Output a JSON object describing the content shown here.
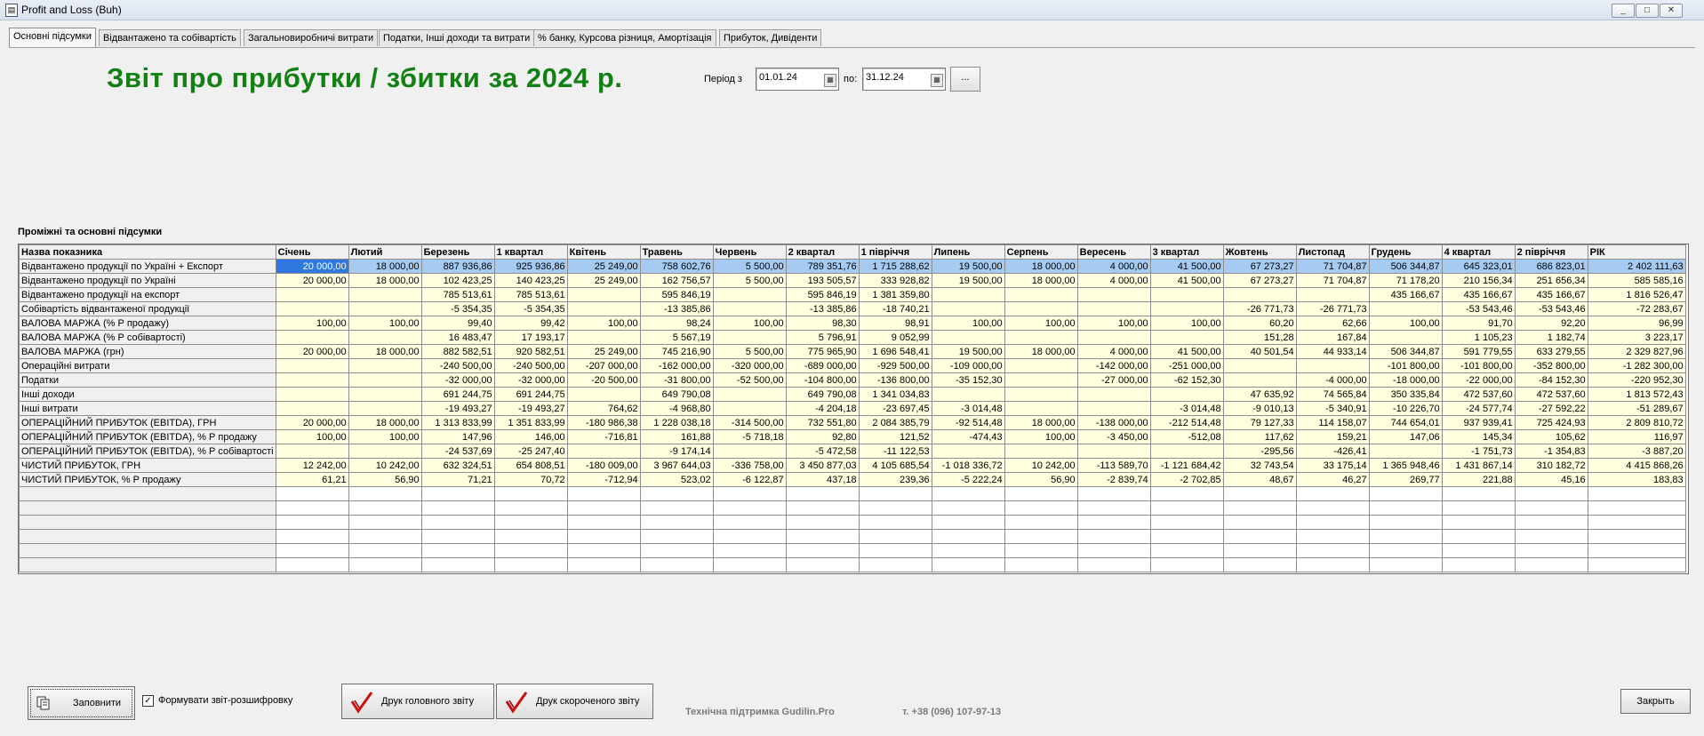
{
  "window": {
    "title": "Profit and Loss (Buh)",
    "minimize": "_",
    "maximize": "□",
    "close": "✕"
  },
  "tabs": [
    {
      "label": "Основні підсумки"
    },
    {
      "label": "Відвантажено та собівартість"
    },
    {
      "label": "Загальновиробничі витрати"
    },
    {
      "label": "Податки, Інші доходи та витрати"
    },
    {
      "label": "% банку, Курсова різниця, Амортізація"
    },
    {
      "label": "Прибуток, Дивіденти"
    }
  ],
  "report": {
    "title": "Звіт про прибутки / збитки за 2024 р.",
    "period_label": "Період з",
    "date_from": "01.01.24",
    "to_label": "по:",
    "date_to": "31.12.24",
    "more_button": "...",
    "section_title": "Проміжні та основні підсумки"
  },
  "table": {
    "columns": [
      "Назва показника",
      "Січень",
      "Лютий",
      "Березень",
      "1 квартал",
      "Квітень",
      "Травень",
      "Червень",
      "2 квартал",
      "1 півріччя",
      "Липень",
      "Серпень",
      "Вересень",
      "3 квартал",
      "Жовтень",
      "Листопад",
      "Грудень",
      "4 квартал",
      "2 півріччя",
      "РІК"
    ],
    "rows": [
      [
        "Відвантажено продукції по Україні + Експорт",
        "20 000,00",
        "18 000,00",
        "887 936,86",
        "925 936,86",
        "25 249,00",
        "758 602,76",
        "5 500,00",
        "789 351,76",
        "1 715 288,62",
        "19 500,00",
        "18 000,00",
        "4 000,00",
        "41 500,00",
        "67 273,27",
        "71 704,87",
        "506 344,87",
        "645 323,01",
        "686 823,01",
        "2 402 111,63"
      ],
      [
        "Відвантажено продукції по Україні",
        "20 000,00",
        "18 000,00",
        "102 423,25",
        "140 423,25",
        "25 249,00",
        "162 756,57",
        "5 500,00",
        "193 505,57",
        "333 928,82",
        "19 500,00",
        "18 000,00",
        "4 000,00",
        "41 500,00",
        "67 273,27",
        "71 704,87",
        "71 178,20",
        "210 156,34",
        "251 656,34",
        "585 585,16"
      ],
      [
        "Відвантажено продукції на експорт",
        "",
        "",
        "785 513,61",
        "785 513,61",
        "",
        "595 846,19",
        "",
        "595 846,19",
        "1 381 359,80",
        "",
        "",
        "",
        "",
        "",
        "",
        "435 166,67",
        "435 166,67",
        "435 166,67",
        "1 816 526,47"
      ],
      [
        "Собівартість відвантаженої продукції",
        "",
        "",
        "-5 354,35",
        "-5 354,35",
        "",
        "-13 385,86",
        "",
        "-13 385,86",
        "-18 740,21",
        "",
        "",
        "",
        "",
        "-26 771,73",
        "-26 771,73",
        "",
        "-53 543,46",
        "-53 543,46",
        "-72 283,67"
      ],
      [
        "ВАЛОВА МАРЖА (% Р продажу)",
        "100,00",
        "100,00",
        "99,40",
        "99,42",
        "100,00",
        "98,24",
        "100,00",
        "98,30",
        "98,91",
        "100,00",
        "100,00",
        "100,00",
        "100,00",
        "60,20",
        "62,66",
        "100,00",
        "91,70",
        "92,20",
        "96,99"
      ],
      [
        "ВАЛОВА МАРЖА (% Р собівартості)",
        "",
        "",
        "16 483,47",
        "17 193,17",
        "",
        "5 567,19",
        "",
        "5 796,91",
        "9 052,99",
        "",
        "",
        "",
        "",
        "151,28",
        "167,84",
        "",
        "1 105,23",
        "1 182,74",
        "3 223,17"
      ],
      [
        "ВАЛОВА МАРЖА (грн)",
        "20 000,00",
        "18 000,00",
        "882 582,51",
        "920 582,51",
        "25 249,00",
        "745 216,90",
        "5 500,00",
        "775 965,90",
        "1 696 548,41",
        "19 500,00",
        "18 000,00",
        "4 000,00",
        "41 500,00",
        "40 501,54",
        "44 933,14",
        "506 344,87",
        "591 779,55",
        "633 279,55",
        "2 329 827,96"
      ],
      [
        "Операційні витрати",
        "",
        "",
        "-240 500,00",
        "-240 500,00",
        "-207 000,00",
        "-162 000,00",
        "-320 000,00",
        "-689 000,00",
        "-929 500,00",
        "-109 000,00",
        "",
        "-142 000,00",
        "-251 000,00",
        "",
        "",
        "-101 800,00",
        "-101 800,00",
        "-352 800,00",
        "-1 282 300,00"
      ],
      [
        "Податки",
        "",
        "",
        "-32 000,00",
        "-32 000,00",
        "-20 500,00",
        "-31 800,00",
        "-52 500,00",
        "-104 800,00",
        "-136 800,00",
        "-35 152,30",
        "",
        "-27 000,00",
        "-62 152,30",
        "",
        "-4 000,00",
        "-18 000,00",
        "-22 000,00",
        "-84 152,30",
        "-220 952,30"
      ],
      [
        "Інші доходи",
        "",
        "",
        "691 244,75",
        "691 244,75",
        "",
        "649 790,08",
        "",
        "649 790,08",
        "1 341 034,83",
        "",
        "",
        "",
        "",
        "47 635,92",
        "74 565,84",
        "350 335,84",
        "472 537,60",
        "472 537,60",
        "1 813 572,43"
      ],
      [
        "Інші витрати",
        "",
        "",
        "-19 493,27",
        "-19 493,27",
        "764,62",
        "-4 968,80",
        "",
        "-4 204,18",
        "-23 697,45",
        "-3 014,48",
        "",
        "",
        "-3 014,48",
        "-9 010,13",
        "-5 340,91",
        "-10 226,70",
        "-24 577,74",
        "-27 592,22",
        "-51 289,67"
      ],
      [
        "ОПЕРАЦІЙНИЙ ПРИБУТОК (EBITDA), ГРН",
        "20 000,00",
        "18 000,00",
        "1 313 833,99",
        "1 351 833,99",
        "-180 986,38",
        "1 228 038,18",
        "-314 500,00",
        "732 551,80",
        "2 084 385,79",
        "-92 514,48",
        "18 000,00",
        "-138 000,00",
        "-212 514,48",
        "79 127,33",
        "114 158,07",
        "744 654,01",
        "937 939,41",
        "725 424,93",
        "2 809 810,72"
      ],
      [
        "ОПЕРАЦІЙНИЙ ПРИБУТОК (EBITDA), % Р продажу",
        "100,00",
        "100,00",
        "147,96",
        "146,00",
        "-716,81",
        "161,88",
        "-5 718,18",
        "92,80",
        "121,52",
        "-474,43",
        "100,00",
        "-3 450,00",
        "-512,08",
        "117,62",
        "159,21",
        "147,06",
        "145,34",
        "105,62",
        "116,97"
      ],
      [
        "ОПЕРАЦІЙНИЙ ПРИБУТОК (EBITDA), % Р собівартості",
        "",
        "",
        "-24 537,69",
        "-25 247,40",
        "",
        "-9 174,14",
        "",
        "-5 472,58",
        "-11 122,53",
        "",
        "",
        "",
        "",
        "-295,56",
        "-426,41",
        "",
        "-1 751,73",
        "-1 354,83",
        "-3 887,20"
      ],
      [
        "ЧИСТИЙ ПРИБУТОК, ГРН",
        "12 242,00",
        "10 242,00",
        "632 324,51",
        "654 808,51",
        "-180 009,00",
        "3 967 644,03",
        "-336 758,00",
        "3 450 877,03",
        "4 105 685,54",
        "-1 018 336,72",
        "10 242,00",
        "-113 589,70",
        "-1 121 684,42",
        "32 743,54",
        "33 175,14",
        "1 365 948,46",
        "1 431 867,14",
        "310 182,72",
        "4 415 868,26"
      ],
      [
        "ЧИСТИЙ ПРИБУТОК, % Р продажу",
        "61,21",
        "56,90",
        "71,21",
        "70,72",
        "-712,94",
        "523,02",
        "-6 122,87",
        "437,18",
        "239,36",
        "-5 222,24",
        "56,90",
        "-2 839,74",
        "-2 702,85",
        "48,67",
        "46,27",
        "269,77",
        "221,88",
        "45,16",
        "183,83"
      ]
    ]
  },
  "footer": {
    "fill_button": "Заповнити",
    "checkbox_label": "Формувати звіт-розшифровку",
    "checkbox_checked": "✓",
    "print_main": "Друк головного звіту",
    "print_short": "Друк скороченого звіту",
    "support_text": "Технічна підтримка Gudilin.Pro",
    "phone": "т. +38 (096) 107-97-13",
    "close_button": "Закрыть"
  },
  "colors": {
    "title_green": "#128012",
    "cell_yellow": "#ffffe0",
    "selection_blue": "#3d7fe6",
    "check_red": "#cc1010"
  }
}
